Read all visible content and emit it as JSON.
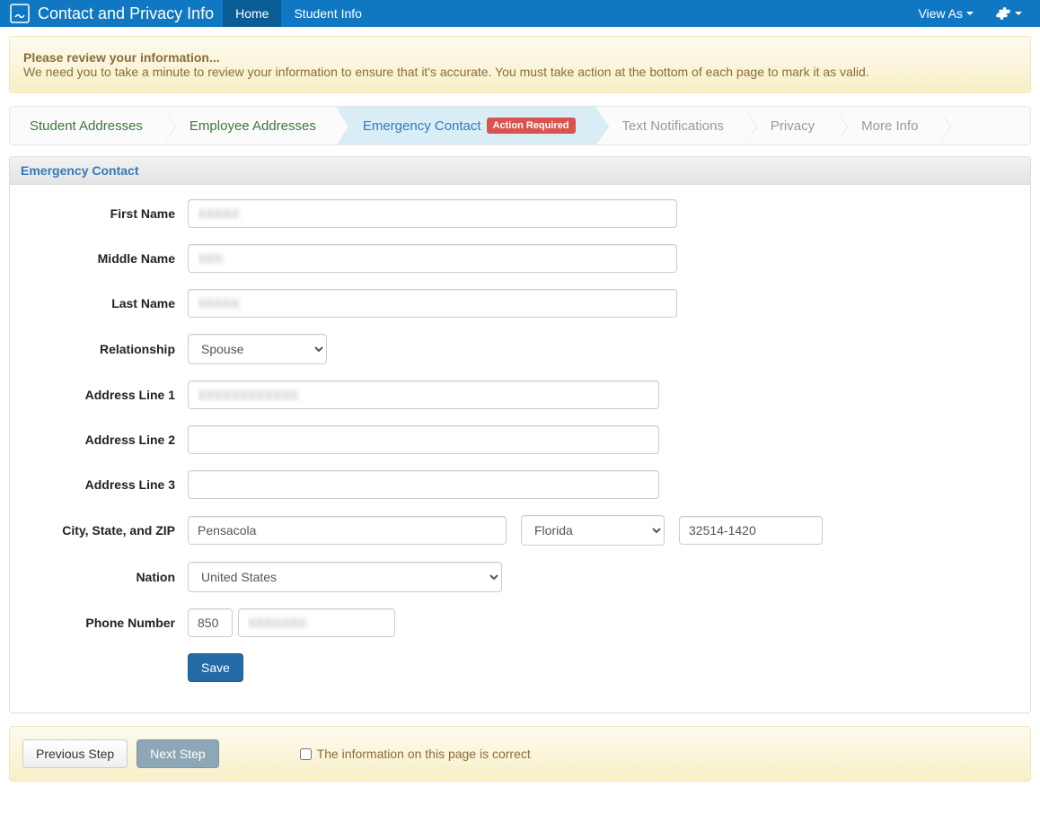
{
  "navbar": {
    "title": "Contact and Privacy Info",
    "items": [
      {
        "label": "Home",
        "active": true
      },
      {
        "label": "Student Info",
        "active": false
      }
    ],
    "view_as": "View As"
  },
  "alert": {
    "title": "Please review your information...",
    "body": "We need you to take a minute to review your information to ensure that it's accurate. You must take action at the bottom of each page to mark it as valid."
  },
  "wizard": [
    {
      "label": "Student Addresses",
      "state": "done"
    },
    {
      "label": "Employee Addresses",
      "state": "done"
    },
    {
      "label": "Emergency Contact",
      "state": "active",
      "badge": "Action Required"
    },
    {
      "label": "Text Notifications",
      "state": "todo"
    },
    {
      "label": "Privacy",
      "state": "todo"
    },
    {
      "label": "More Info",
      "state": "todo"
    }
  ],
  "panel": {
    "heading": "Emergency Contact",
    "fields": {
      "first_name_label": "First Name",
      "first_name_value": "XXXXX",
      "middle_name_label": "Middle Name",
      "middle_name_value": "XXX",
      "last_name_label": "Last Name",
      "last_name_value": "XXXXX",
      "relationship_label": "Relationship",
      "relationship_value": "Spouse",
      "address1_label": "Address Line 1",
      "address1_value": "XXXXXXXXXXXX",
      "address2_label": "Address Line 2",
      "address2_value": "",
      "address3_label": "Address Line 3",
      "address3_value": "",
      "csz_label": "City, State, and ZIP",
      "city_value": "Pensacola",
      "state_value": "Florida",
      "zip_value": "32514-1420",
      "nation_label": "Nation",
      "nation_value": "United States",
      "phone_label": "Phone Number",
      "area_value": "850",
      "phone_value": "XXXXXXX",
      "save_label": "Save"
    }
  },
  "footer": {
    "prev": "Previous Step",
    "next": "Next Step",
    "confirm": "The information on this page is correct"
  }
}
